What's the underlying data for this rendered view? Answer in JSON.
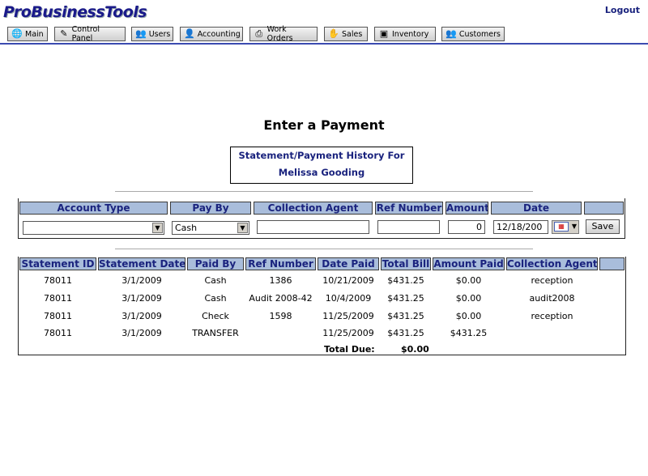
{
  "app": {
    "logo": "ProBusinessTools",
    "logout": "Logout"
  },
  "tabs": [
    {
      "label": "Main",
      "icon": "globe-icon"
    },
    {
      "label": "Control Panel",
      "icon": "wand-icon"
    },
    {
      "label": "Users",
      "icon": "users-icon"
    },
    {
      "label": "Accounting",
      "icon": "person-icon"
    },
    {
      "label": "Work Orders",
      "icon": "printer-icon"
    },
    {
      "label": "Sales",
      "icon": "sales-icon"
    },
    {
      "label": "Inventory",
      "icon": "box-icon"
    },
    {
      "label": "Customers",
      "icon": "customers-icon"
    }
  ],
  "page": {
    "title": "Enter a Payment",
    "history_line1": "Statement/Payment History For",
    "history_line2": "Melissa Gooding"
  },
  "form": {
    "headers": [
      "Account Type",
      "Pay By",
      "Collection Agent",
      "Ref Number",
      "Amount",
      "Date",
      ""
    ],
    "account_type": "",
    "pay_by": "Cash",
    "collection_agent": "",
    "ref_number": "",
    "amount": "0",
    "date": "12/18/200",
    "save_label": "Save"
  },
  "history": {
    "headers": [
      "Statement ID",
      "Statement Date",
      "Paid By",
      "Ref Number",
      "Date Paid",
      "Total Bill",
      "Amount Paid",
      "Collection Agent",
      ""
    ],
    "rows": [
      [
        "78011",
        "3/1/2009",
        "Cash",
        "1386",
        "10/21/2009",
        "$431.25",
        "$0.00",
        "reception"
      ],
      [
        "78011",
        "3/1/2009",
        "Cash",
        "Audit 2008-42",
        "10/4/2009",
        "$431.25",
        "$0.00",
        "audit2008"
      ],
      [
        "78011",
        "3/1/2009",
        "Check",
        "1598",
        "11/25/2009",
        "$431.25",
        "$0.00",
        "reception"
      ],
      [
        "78011",
        "3/1/2009",
        "TRANSFER",
        "",
        "11/25/2009",
        "$431.25",
        "$431.25",
        ""
      ]
    ],
    "total_label": "Total Due:",
    "total_value": "$0.00"
  }
}
